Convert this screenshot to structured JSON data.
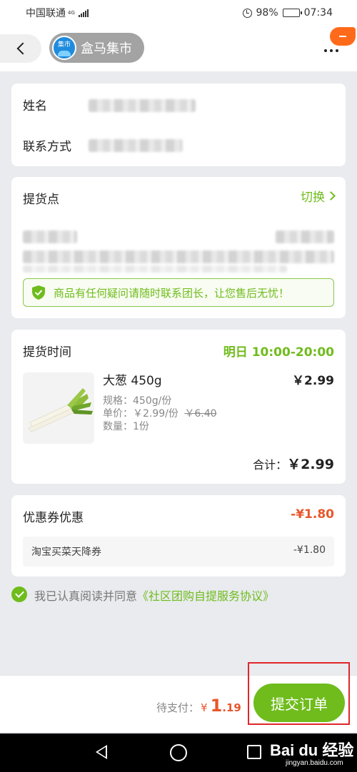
{
  "status_bar": {
    "carrier": "中国联通",
    "network": "4G",
    "battery": "98%",
    "time": "07:34"
  },
  "header": {
    "store_logo_text": "集市",
    "store_name": "盒马集市"
  },
  "contact": {
    "name_label": "姓名",
    "contact_label": "联系方式"
  },
  "pickup": {
    "title": "提货点",
    "switch_label": "切换",
    "notice": "商品有任何疑问请随时联系团长，让您售后无忧！"
  },
  "order": {
    "time_label": "提货时间",
    "time_day": "明日",
    "time_range": "10:00-20:00",
    "product_name": "大葱 450g",
    "price": "￥2.99",
    "spec": "规格：450g/份",
    "unit_price_label": "单价：",
    "unit_price": "￥2.99/份",
    "original_price": "￥6.40",
    "quantity": "数量：1份",
    "total_label": "合计：",
    "total": "￥2.99"
  },
  "coupon": {
    "title": "优惠券优惠",
    "amount": "-¥1.80",
    "item_name": "淘宝买菜天降券",
    "item_amount": "-¥1.80"
  },
  "agreement": {
    "text": "我已认真阅读并同意",
    "link": "《社区团购自提服务协议》"
  },
  "bottom": {
    "pay_label": "待支付：",
    "currency": "¥",
    "amount_int": "1",
    "amount_dec": ".19",
    "submit_label": "提交订单"
  },
  "watermark": {
    "brand": "Bai du 经验",
    "sub": "jingyan.baidu.com"
  },
  "colors": {
    "accent_green": "#6fbc1c",
    "price_orange": "#e8562a",
    "highlight_red": "#e0262a"
  }
}
